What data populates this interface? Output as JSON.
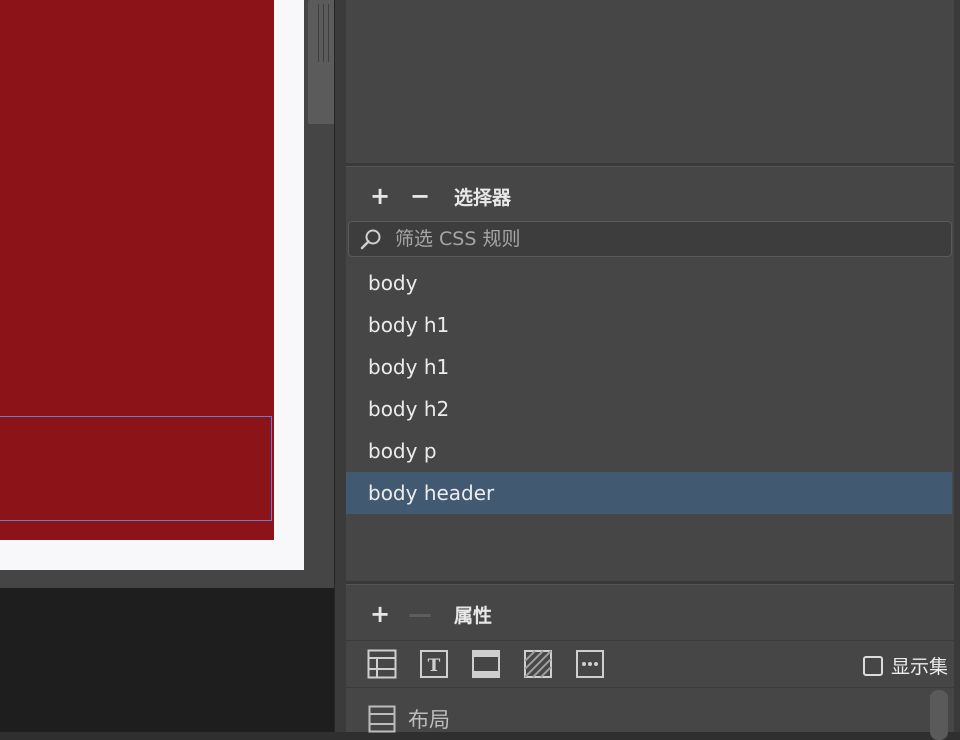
{
  "selector_panel": {
    "add_label": "+",
    "remove_label": "−",
    "title": "选择器",
    "filter_placeholder": "筛选 CSS 规则",
    "selectors": [
      "body",
      "body h1",
      "body h1",
      "body h2",
      "body p",
      "body header"
    ],
    "selected_index": 5
  },
  "properties_panel": {
    "add_label": "+",
    "remove_label": "—",
    "title": "属性",
    "show_set_label": "显示集",
    "show_set_checked": false,
    "category_icons": [
      "layout-icon",
      "text-icon",
      "border-icon",
      "background-icon",
      "more-icon"
    ],
    "first_category": "布局"
  },
  "colors": {
    "canvas_red": "#8c1318",
    "panel_bg": "#464646",
    "selected_row": "#415a72",
    "selection_outline": "#6b7bd1"
  }
}
